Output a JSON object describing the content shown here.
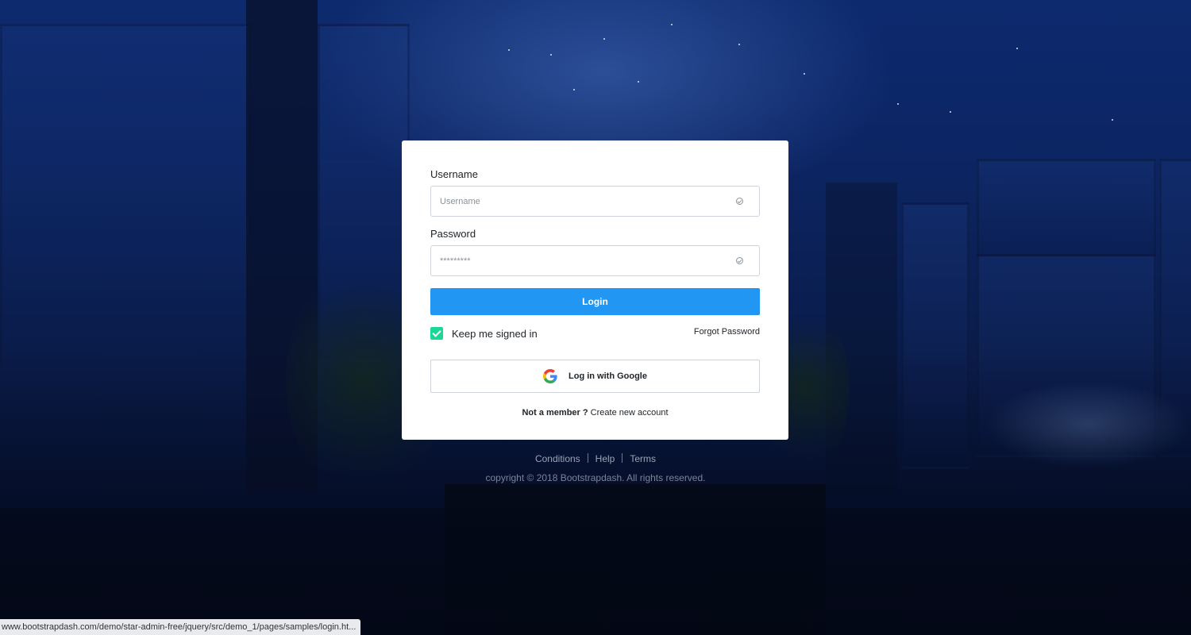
{
  "login_card": {
    "username": {
      "label": "Username",
      "placeholder": "Username",
      "value": ""
    },
    "password": {
      "label": "Password",
      "placeholder": "*********",
      "value": ""
    },
    "login_button": "Login",
    "remember_me": {
      "label": "Keep me signed in",
      "checked": true
    },
    "forgot_password": "Forgot Password",
    "google_button": {
      "label": "Log in with Google",
      "icon": "google-icon"
    },
    "signup_prompt": {
      "question": "Not a member ?",
      "link": "Create new account"
    }
  },
  "footer": {
    "links": [
      "Conditions",
      "Help",
      "Terms"
    ],
    "copyright": "copyright © 2018 Bootstrapdash. All rights reserved."
  },
  "status_bar": {
    "url": "www.bootstrapdash.com/demo/star-admin-free/jquery/src/demo_1/pages/samples/login.ht..."
  },
  "colors": {
    "primary": "#2196f3",
    "checkbox": "#19d895"
  }
}
